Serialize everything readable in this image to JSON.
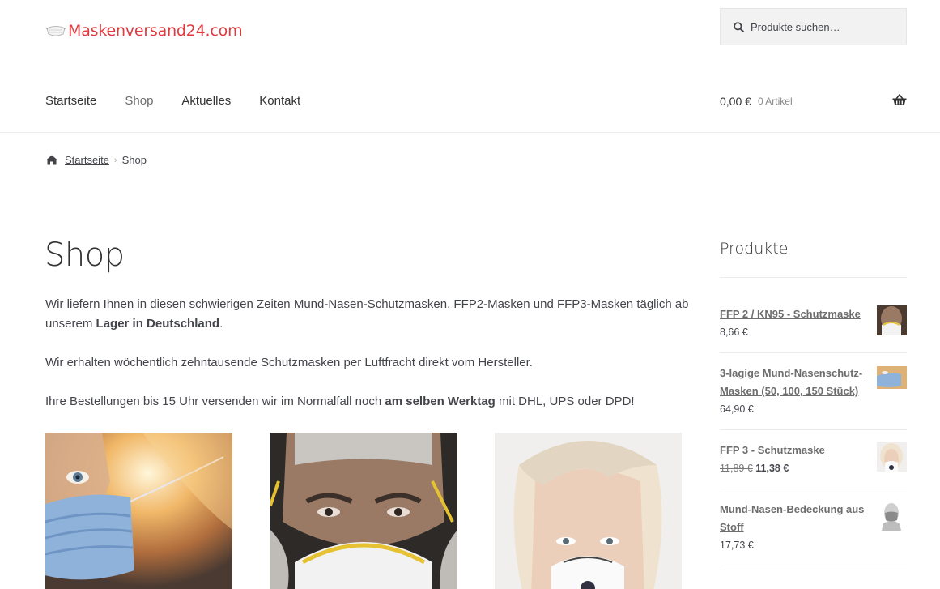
{
  "header": {
    "logo_text": "Maskenversand24.com",
    "search_placeholder": "Produkte suchen…",
    "nav": [
      "Startseite",
      "Shop",
      "Aktuelles",
      "Kontakt"
    ],
    "cart_amount": "0,00 €",
    "cart_count": "0 Artikel"
  },
  "breadcrumb": {
    "home": "Startseite",
    "current": "Shop"
  },
  "main": {
    "title": "Shop",
    "p1_a": "Wir liefern Ihnen in diesen schwierigen Zeiten Mund-Nasen-Schutzmasken, FFP2-Masken und FFP3-Masken täglich ab unserem ",
    "p1_b": "Lager in Deutschland",
    "p1_c": ".",
    "p2": "Wir erhalten wöchentlich zehntausende Schutzmasken per Luftfracht direkt vom Hersteller.",
    "p3_a": "Ihre Bestellungen bis 15 Uhr versenden wir im Normalfall noch ",
    "p3_b": "am selben Werktag",
    "p3_c": " mit DHL, UPS oder DPD!"
  },
  "sidebar": {
    "title": "Produkte",
    "products": [
      {
        "name": "FFP 2 / KN95 - Schutzmaske",
        "price": "8,66 €"
      },
      {
        "name": "3-lagige Mund-Nasenschutz-Masken (50, 100, 150 Stück)",
        "price": "64,90 €"
      },
      {
        "name": "FFP 3 - Schutzmaske",
        "old_price": "11,89 €",
        "price": "11,38 €"
      },
      {
        "name": "Mund-Nasen-Bedeckung aus Stoff",
        "price": "17,73 €"
      }
    ]
  },
  "colors": {
    "logo": "#e2393f",
    "text": "#43454b",
    "link": "#6d6d6d"
  }
}
